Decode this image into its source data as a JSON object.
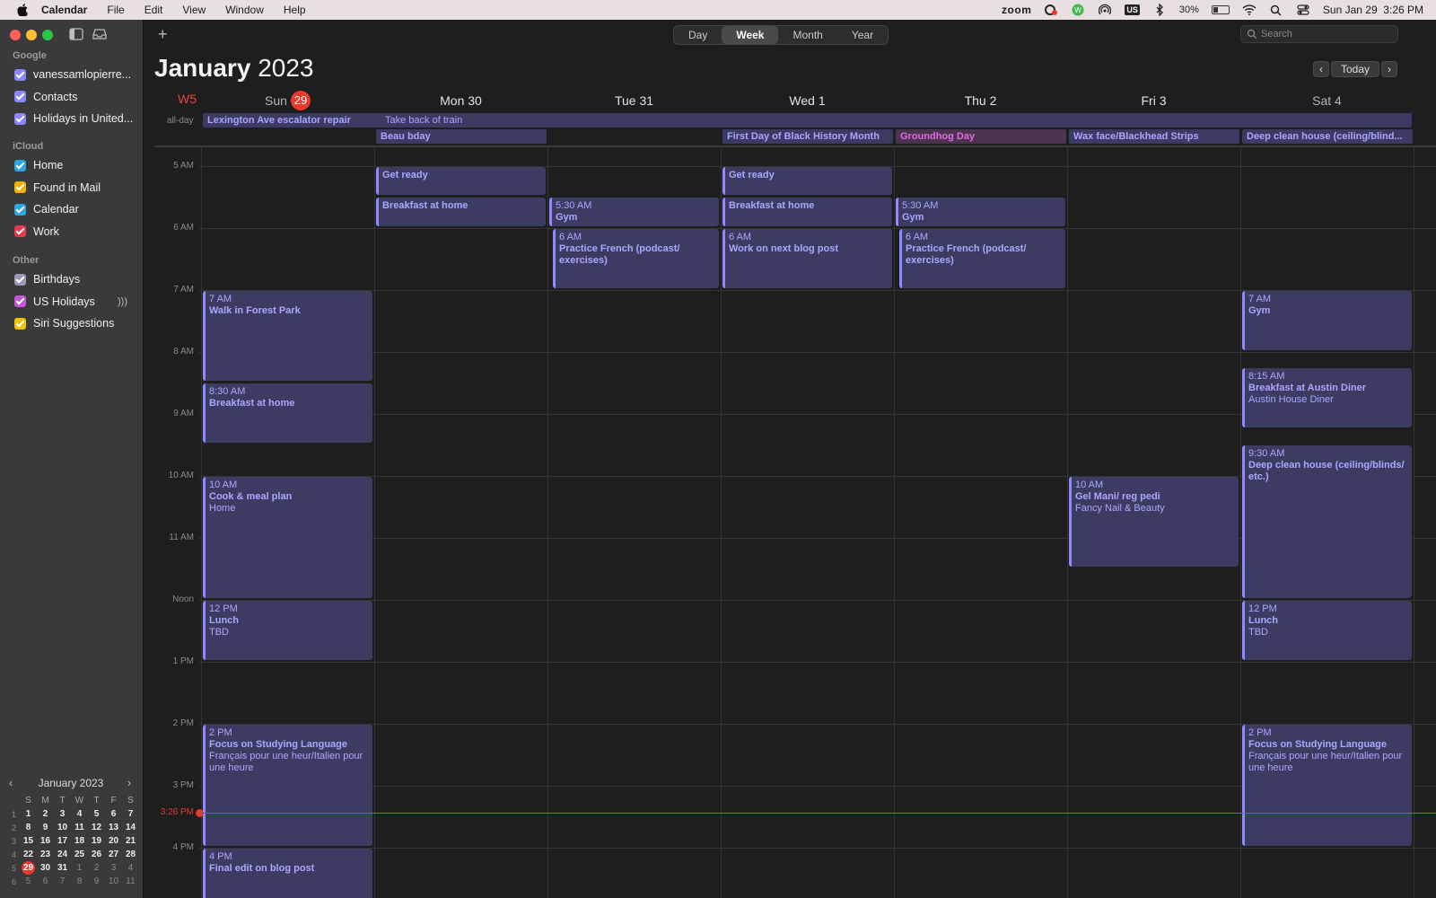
{
  "menubar": {
    "app_name": "Calendar",
    "menus": [
      "File",
      "Edit",
      "View",
      "Window",
      "Help"
    ],
    "zoom": "zoom",
    "keyboard": "US",
    "battery": "30%",
    "datetime": "Sun Jan 29  3:26 PM"
  },
  "sidebar": {
    "groups": [
      {
        "label": "Google",
        "items": [
          {
            "label": "vanessamlopierre...",
            "color": "#8b86ff"
          },
          {
            "label": "Contacts",
            "color": "#8b86ff"
          },
          {
            "label": "Holidays in United...",
            "color": "#8b86ff"
          }
        ]
      },
      {
        "label": "iCloud",
        "items": [
          {
            "label": "Home",
            "color": "#2ca6e0"
          },
          {
            "label": "Found in Mail",
            "color": "#f0b400"
          },
          {
            "label": "Calendar",
            "color": "#2ca6e0"
          },
          {
            "label": "Work",
            "color": "#e7384c"
          }
        ]
      },
      {
        "label": "Other",
        "items": [
          {
            "label": "Birthdays",
            "color": "#9a9ab8"
          },
          {
            "label": "US Holidays",
            "color": "#c456d8"
          },
          {
            "label": "Siri Suggestions",
            "color": "#f0c400"
          }
        ]
      }
    ]
  },
  "mini_calendar": {
    "title": "January 2023",
    "weekday_headers": [
      "S",
      "M",
      "T",
      "W",
      "T",
      "F",
      "S"
    ],
    "weeks": [
      {
        "num": "1",
        "days": [
          "1",
          "2",
          "3",
          "4",
          "5",
          "6",
          "7"
        ]
      },
      {
        "num": "2",
        "days": [
          "8",
          "9",
          "10",
          "11",
          "12",
          "13",
          "14"
        ]
      },
      {
        "num": "3",
        "days": [
          "15",
          "16",
          "17",
          "18",
          "19",
          "20",
          "21"
        ]
      },
      {
        "num": "4",
        "days": [
          "22",
          "23",
          "24",
          "25",
          "26",
          "27",
          "28"
        ]
      },
      {
        "num": "5",
        "days": [
          "29",
          "30",
          "31",
          "1",
          "2",
          "3",
          "4"
        ]
      },
      {
        "num": "6",
        "days": [
          "5",
          "6",
          "7",
          "8",
          "9",
          "10",
          "11"
        ]
      }
    ]
  },
  "toolbar": {
    "views": [
      "Day",
      "Week",
      "Month",
      "Year"
    ],
    "active_view": "Week",
    "search_placeholder": "Search",
    "today_label": "Today"
  },
  "header": {
    "month": "January",
    "year": "2023",
    "week_label": "W5"
  },
  "days": [
    {
      "label": "Sun",
      "date": "29",
      "today": true
    },
    {
      "label": "Mon 30"
    },
    {
      "label": "Tue 31"
    },
    {
      "label": "Wed 1"
    },
    {
      "label": "Thu 2"
    },
    {
      "label": "Fri 3"
    },
    {
      "label": "Sat 4"
    }
  ],
  "allday_label": "all-day",
  "allday_events": [
    {
      "title": "Lexington Ave escalator repair",
      "day": 0,
      "span": 7,
      "row": 0,
      "style": "purple"
    },
    {
      "title": "Take back of train",
      "day": 1,
      "span": 1,
      "row": 0,
      "style": "none"
    },
    {
      "title": "Beau bday",
      "day": 1,
      "span": 1,
      "row": 1,
      "style": "purple"
    },
    {
      "title": "First Day of Black History Month",
      "day": 3,
      "span": 1,
      "row": 1,
      "style": "purple"
    },
    {
      "title": "Groundhog Day",
      "day": 4,
      "span": 1,
      "row": 1,
      "style": "pink"
    },
    {
      "title": "Wax face/Blackhead Strips",
      "day": 5,
      "span": 1,
      "row": 1,
      "style": "purple"
    },
    {
      "title": "Deep clean house (ceiling/blind...",
      "day": 6,
      "span": 1,
      "row": 1,
      "style": "purple"
    }
  ],
  "hours": [
    "5 AM",
    "6 AM",
    "7 AM",
    "8 AM",
    "9 AM",
    "10 AM",
    "11 AM",
    "Noon",
    "1 PM",
    "2 PM",
    "3 PM",
    "4 PM"
  ],
  "now_label": "3:26 PM",
  "events": [
    {
      "day": 0,
      "start": 7.0,
      "end": 8.5,
      "time": "7 AM",
      "title": "Walk in Forest Park"
    },
    {
      "day": 0,
      "start": 8.5,
      "end": 9.5,
      "time": "8:30 AM",
      "title": "Breakfast at home"
    },
    {
      "day": 0,
      "start": 10.0,
      "end": 12.0,
      "time": "10 AM",
      "title": "Cook & meal plan",
      "location": "Home"
    },
    {
      "day": 0,
      "start": 12.0,
      "end": 13.0,
      "time": "12 PM",
      "title": "Lunch",
      "location": "TBD"
    },
    {
      "day": 0,
      "start": 14.0,
      "end": 16.0,
      "time": "2 PM",
      "title": "Focus on Studying Language",
      "location": "Français pour une heur/Italien pour une heure"
    },
    {
      "day": 0,
      "start": 16.0,
      "end": 16.9,
      "time": "4 PM",
      "title": "Final edit on blog post"
    },
    {
      "day": 1,
      "start": 5.0,
      "end": 5.5,
      "title": "Get ready"
    },
    {
      "day": 1,
      "start": 5.5,
      "end": 6.0,
      "title": "Breakfast at home"
    },
    {
      "day": 2,
      "start": 5.5,
      "end": 6.0,
      "time": "5:30 AM",
      "title": "Gym"
    },
    {
      "day": 2,
      "start": 6.0,
      "end": 7.0,
      "time": "6 AM",
      "title": "Practice French (podcast/ exercises)",
      "indent": true
    },
    {
      "day": 3,
      "start": 5.0,
      "end": 5.5,
      "title": "Get ready"
    },
    {
      "day": 3,
      "start": 5.5,
      "end": 6.0,
      "title": "Breakfast at home"
    },
    {
      "day": 3,
      "start": 6.0,
      "end": 7.0,
      "time": "6 AM",
      "title": "Work on next blog post"
    },
    {
      "day": 4,
      "start": 5.5,
      "end": 6.0,
      "time": "5:30 AM",
      "title": "Gym"
    },
    {
      "day": 4,
      "start": 6.0,
      "end": 7.0,
      "time": "6 AM",
      "title": "Practice French (podcast/ exercises)",
      "indent": true
    },
    {
      "day": 5,
      "start": 10.0,
      "end": 11.5,
      "time": "10 AM",
      "title": "Gel Mani/ reg pedi",
      "location": "Fancy Nail & Beauty"
    },
    {
      "day": 6,
      "start": 7.0,
      "end": 8.0,
      "time": "7 AM",
      "title": "Gym"
    },
    {
      "day": 6,
      "start": 8.25,
      "end": 9.25,
      "time": "8:15 AM",
      "title": "Breakfast at Austin Diner",
      "location": "Austin House Diner"
    },
    {
      "day": 6,
      "start": 9.5,
      "end": 12.0,
      "time": "9:30 AM",
      "title": "Deep clean house (ceiling/blinds/ etc.)"
    },
    {
      "day": 6,
      "start": 12.0,
      "end": 13.0,
      "time": "12 PM",
      "title": "Lunch",
      "location": "TBD"
    },
    {
      "day": 6,
      "start": 14.0,
      "end": 16.0,
      "time": "2 PM",
      "title": "Focus on Studying Language",
      "location": "Français pour une heur/Italien pour une heure"
    }
  ]
}
